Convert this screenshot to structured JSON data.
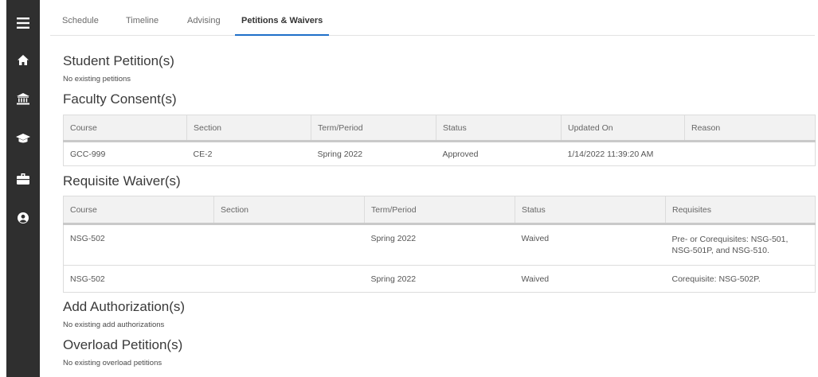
{
  "sidebar": {
    "icons": [
      "menu-icon",
      "home-icon",
      "institution-icon",
      "graduation-cap-icon",
      "briefcase-icon",
      "user-circle-icon"
    ]
  },
  "tabs": [
    {
      "label": "Schedule",
      "active": false
    },
    {
      "label": "Timeline",
      "active": false
    },
    {
      "label": "Advising",
      "active": false
    },
    {
      "label": "Petitions & Waivers",
      "active": true
    }
  ],
  "accent_color": "#1f6fc9",
  "student_petitions": {
    "title": "Student Petition(s)",
    "empty_text": "No existing petitions"
  },
  "faculty_consents": {
    "title": "Faculty Consent(s)",
    "columns": [
      "Course",
      "Section",
      "Term/Period",
      "Status",
      "Updated On",
      "Reason"
    ],
    "rows": [
      [
        "GCC-999",
        "CE-2",
        "Spring 2022",
        "Approved",
        "1/14/2022 11:39:20 AM",
        ""
      ]
    ]
  },
  "requisite_waivers": {
    "title": "Requisite Waiver(s)",
    "columns": [
      "Course",
      "Section",
      "Term/Period",
      "Status",
      "Requisites"
    ],
    "rows": [
      [
        "NSG-502",
        "",
        "Spring 2022",
        "Waived",
        "Pre- or Corequisites: NSG-501, NSG-501P, and NSG-510."
      ],
      [
        "NSG-502",
        "",
        "Spring 2022",
        "Waived",
        "Corequisite: NSG-502P."
      ]
    ]
  },
  "add_authorizations": {
    "title": "Add Authorization(s)",
    "empty_text": "No existing add authorizations"
  },
  "overload_petitions": {
    "title": "Overload Petition(s)",
    "empty_text": "No existing overload petitions"
  }
}
